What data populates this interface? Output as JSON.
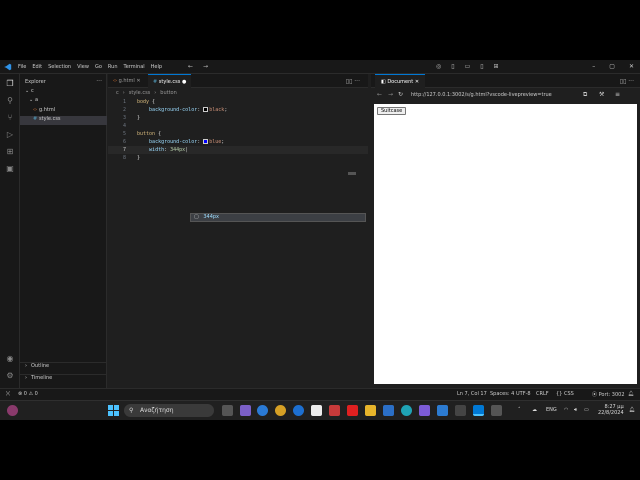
{
  "menu": [
    "File",
    "Edit",
    "Selection",
    "View",
    "Go",
    "Run",
    "Terminal",
    "Help"
  ],
  "sidebar": {
    "title": "Explorer",
    "root": "c",
    "folder": "a",
    "files": [
      {
        "name": "g.html",
        "selected": false
      },
      {
        "name": "style.css",
        "selected": true
      }
    ],
    "outline": "Outline",
    "timeline": "Timeline"
  },
  "editor": {
    "tabs": [
      {
        "label": "g.html",
        "active": false
      },
      {
        "label": "style.css",
        "active": true
      }
    ],
    "breadcrumb": [
      "c",
      "style.css",
      "button"
    ],
    "suggestion": "344px",
    "colors": {
      "black": "#000000",
      "blue": "#0000ff"
    }
  },
  "preview": {
    "tab": "Document",
    "url": "http://127.0.0.1:3002/s/g.html?vscode-livepreview=true",
    "button_label": "Suitcase"
  },
  "statusbar": {
    "problems": "0",
    "warnings": "0",
    "position": "Ln 7, Col 17",
    "spaces": "Spaces: 4",
    "encoding": "UTF-8",
    "eol": "CRLF",
    "language": "CSS",
    "port": "Port: 3002"
  },
  "taskbar": {
    "search_placeholder": "Αναζήτηση",
    "language": "ENG",
    "time": "8:27 μμ",
    "date": "22/8/2024"
  }
}
